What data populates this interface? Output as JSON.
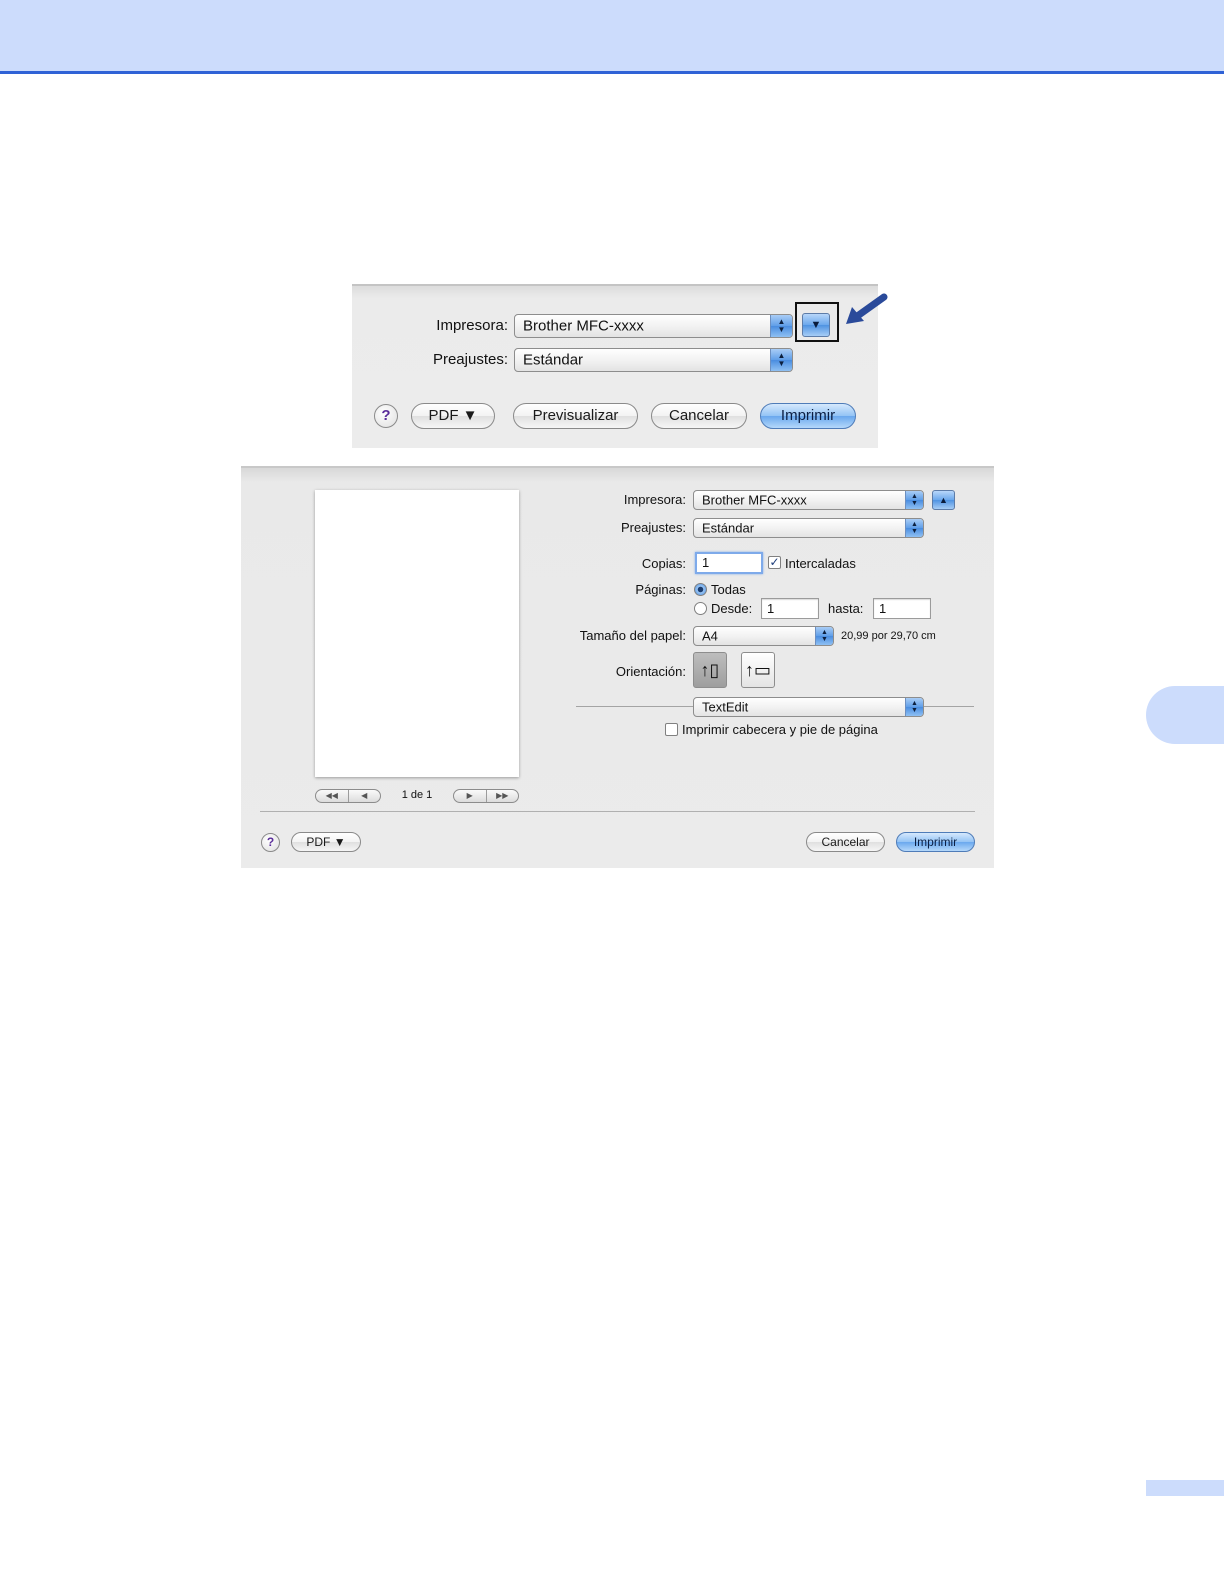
{
  "dialog_collapsed": {
    "printer_label": "Impresora:",
    "printer_value": "Brother MFC-xxxx",
    "presets_label": "Preajustes:",
    "presets_value": "Estándar",
    "help_label": "?",
    "pdf_label": "PDF ▼",
    "preview_label": "Previsualizar",
    "cancel_label": "Cancelar",
    "print_label": "Imprimir",
    "disclosure_glyph": "▼"
  },
  "dialog_expanded": {
    "printer_label": "Impresora:",
    "printer_value": "Brother MFC-xxxx",
    "disclosure_glyph": "▲",
    "presets_label": "Preajustes:",
    "presets_value": "Estándar",
    "copies_label": "Copias:",
    "copies_value": "1",
    "collate_label": "Intercaladas",
    "collate_checked": true,
    "pages_label": "Páginas:",
    "pages_all_label": "Todas",
    "pages_from_label": "Desde:",
    "pages_from_value": "1",
    "pages_to_label": "hasta:",
    "pages_to_value": "1",
    "paper_size_label": "Tamaño del papel:",
    "paper_size_value": "A4",
    "paper_size_dims": "20,99 por 29,70 cm",
    "orientation_label": "Orientación:",
    "app_section_value": "TextEdit",
    "header_footer_label": "Imprimir cabecera y pie de página",
    "header_footer_checked": false,
    "page_indicator": "1 de 1",
    "help_label": "?",
    "pdf_label": "PDF ▼",
    "cancel_label": "Cancelar",
    "print_label": "Imprimir"
  },
  "colors": {
    "header_band": "#ccdcfc",
    "header_rule": "#2f62d6",
    "callout_arrow": "#2a4a9a"
  }
}
